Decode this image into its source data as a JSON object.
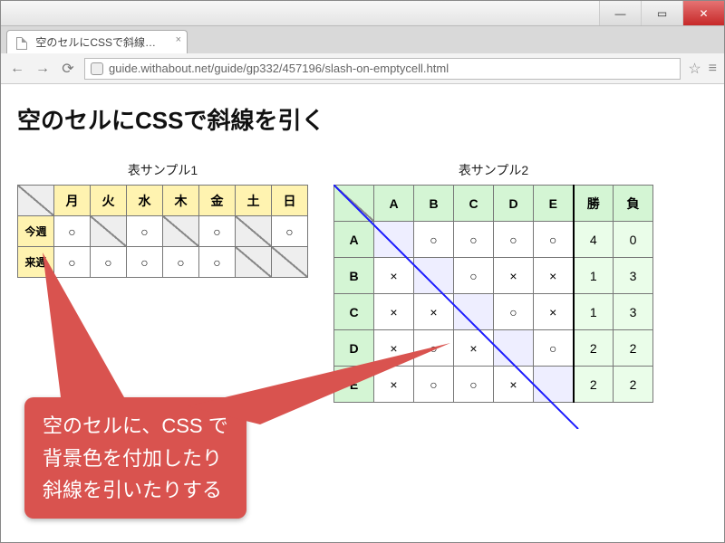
{
  "browser": {
    "tab_title": "空のセルにCSSで斜線を…",
    "url": "guide.withabout.net/guide/gp332/457196/slash-on-emptycell.html"
  },
  "page": {
    "heading": "空のセルにCSSで斜線を引く"
  },
  "table1": {
    "caption": "表サンプル1",
    "cols": [
      "月",
      "火",
      "水",
      "木",
      "金",
      "土",
      "日"
    ],
    "rows": [
      {
        "label": "今週",
        "cells": [
          "○",
          "/",
          "○",
          "/",
          "○",
          "/",
          "○"
        ]
      },
      {
        "label": "来週",
        "cells": [
          "○",
          "○",
          "○",
          "○",
          "○",
          "/",
          "/"
        ]
      }
    ]
  },
  "table2": {
    "caption": "表サンプル2",
    "cols": [
      "A",
      "B",
      "C",
      "D",
      "E"
    ],
    "score_cols": [
      "勝",
      "負"
    ],
    "rows": [
      {
        "label": "A",
        "cells": [
          "",
          "○",
          "○",
          "○",
          "○"
        ],
        "win": "4",
        "lose": "0"
      },
      {
        "label": "B",
        "cells": [
          "×",
          "",
          "○",
          "×",
          "×"
        ],
        "win": "1",
        "lose": "3"
      },
      {
        "label": "C",
        "cells": [
          "×",
          "×",
          "",
          "○",
          "×"
        ],
        "win": "1",
        "lose": "3"
      },
      {
        "label": "D",
        "cells": [
          "×",
          "○",
          "×",
          "",
          "○"
        ],
        "win": "2",
        "lose": "2"
      },
      {
        "label": "E",
        "cells": [
          "×",
          "○",
          "○",
          "×",
          ""
        ],
        "win": "2",
        "lose": "2"
      }
    ]
  },
  "callout": {
    "line1": "空のセルに、CSS で",
    "line2": "背景色を付加したり",
    "line3": "斜線を引いたりする"
  }
}
